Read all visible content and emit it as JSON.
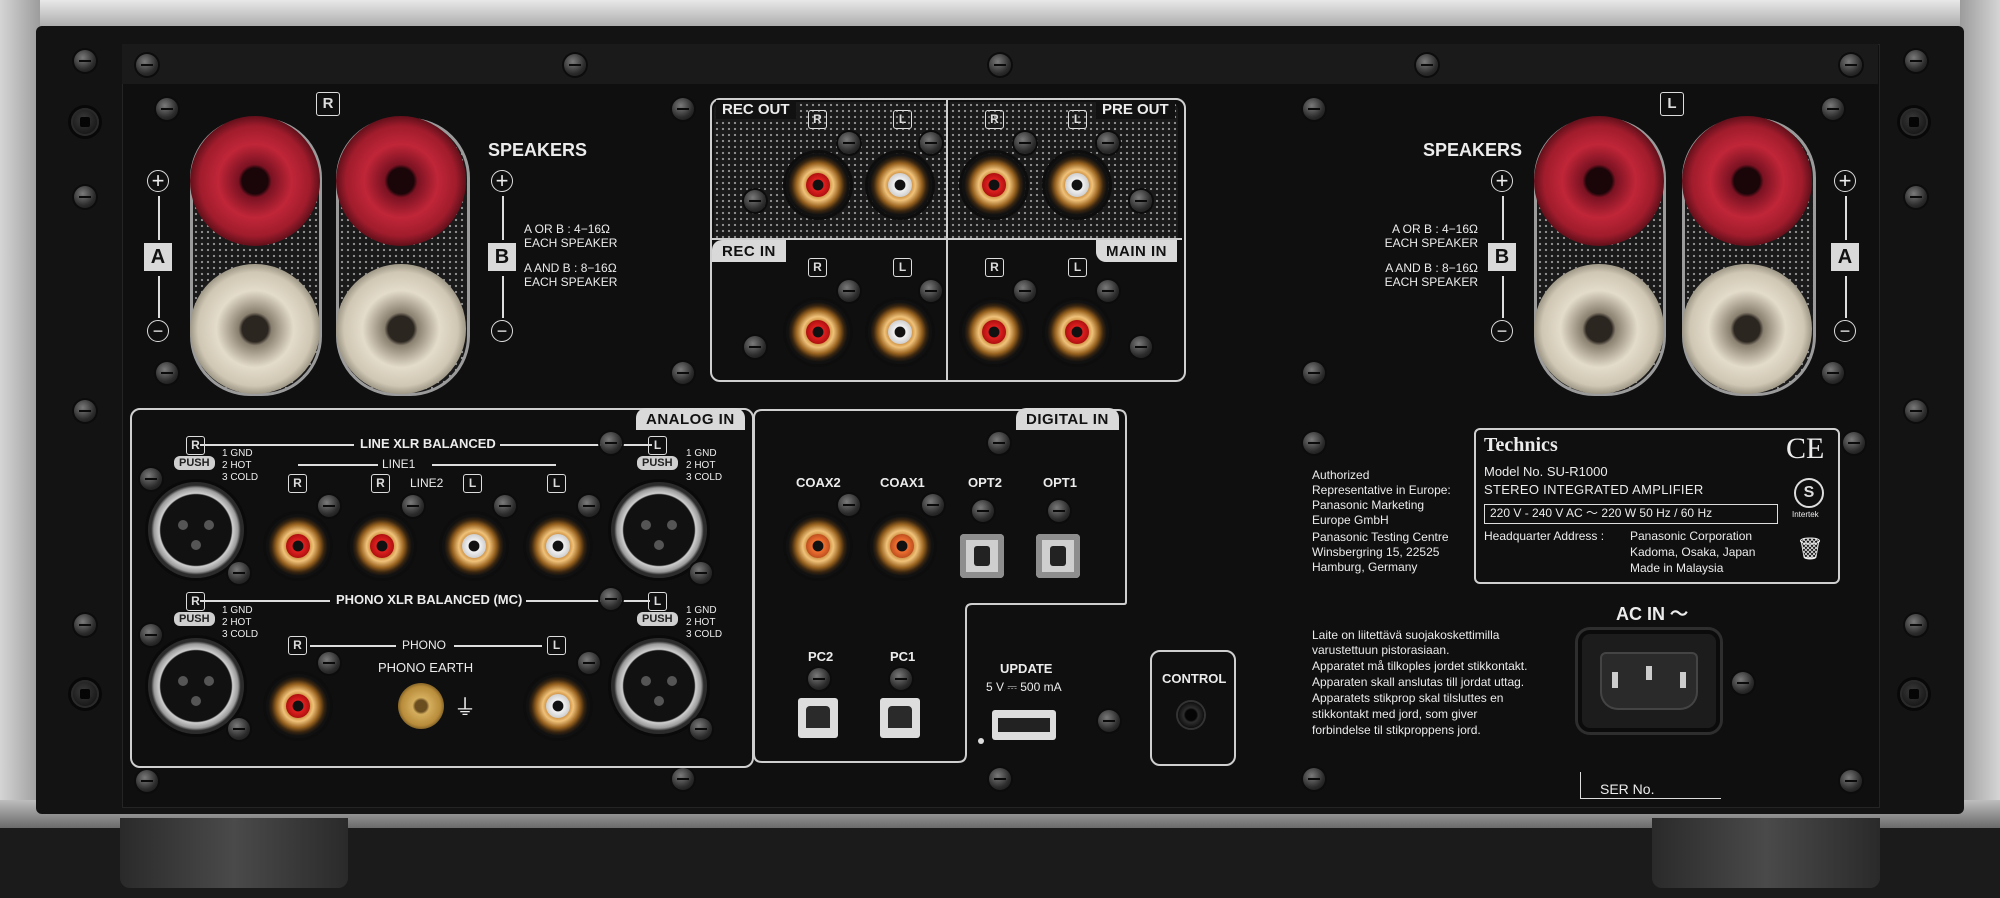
{
  "speakers_right": {
    "channel": "R",
    "title": "SPEAKERS",
    "group_a": "A",
    "group_b": "B",
    "plus": "+",
    "minus": "−",
    "spec_a_or_b_line1": "A OR B : 4−16Ω",
    "spec_a_or_b_line2": "EACH SPEAKER",
    "spec_a_and_b_line1": "A AND B : 8−16Ω",
    "spec_a_and_b_line2": "EACH SPEAKER"
  },
  "speakers_left": {
    "channel": "L",
    "title": "SPEAKERS",
    "group_a": "A",
    "group_b": "B",
    "plus": "+",
    "minus": "−",
    "spec_a_or_b_line1": "A OR B : 4−16Ω",
    "spec_a_or_b_line2": "EACH SPEAKER",
    "spec_a_and_b_line1": "A AND B : 8−16Ω",
    "spec_a_and_b_line2": "EACH SPEAKER"
  },
  "rec_pre": {
    "rec_out": "REC OUT",
    "pre_out": "PRE OUT",
    "rec_in": "REC IN",
    "main_in": "MAIN IN",
    "r": "R",
    "l": "L"
  },
  "analog_in": {
    "tab": "ANALOG IN",
    "line_xlr": "LINE XLR BALANCED",
    "line1": "LINE1",
    "line2": "LINE2",
    "phono_xlr": "PHONO XLR BALANCED (MC)",
    "phono": "PHONO",
    "phono_earth": "PHONO EARTH",
    "push": "PUSH",
    "pin1": "1 GND",
    "pin2": "2 HOT",
    "pin3": "3 COLD",
    "r": "R",
    "l": "L"
  },
  "digital_in": {
    "tab": "DIGITAL IN",
    "coax2": "COAX2",
    "coax1": "COAX1",
    "opt2": "OPT2",
    "opt1": "OPT1",
    "pc2": "PC2",
    "pc1": "PC1"
  },
  "update": {
    "label": "UPDATE",
    "spec": "5 V ⎓ 500 mA"
  },
  "control": {
    "label": "CONTROL"
  },
  "authorized": {
    "lines": [
      "Authorized",
      "Representative in Europe:",
      "Panasonic Marketing",
      "Europe GmbH",
      "Panasonic Testing Centre",
      "Winsbergring 15, 22525",
      "Hamburg, Germany"
    ]
  },
  "rating_plate": {
    "brand": "Technics",
    "model": "Model No.  SU-R1000",
    "type": "STEREO INTEGRATED AMPLIFIER",
    "power": "220 V - 240 V   AC   〜   220 W   50 Hz / 60 Hz",
    "hq_label": "Headquarter Address :",
    "hq_line1": "Panasonic Corporation",
    "hq_line2": "Kadoma, Osaka, Japan",
    "made_in": "Made in Malaysia",
    "ce": "CE",
    "intertek": "Intertek"
  },
  "safety_notice": {
    "lines": [
      "Laite on liitettävä suojakoskettimilla",
      "varustettuun pistorasiaan.",
      "Apparatet må tilkoples jordet stikkontakt.",
      "Apparaten skall anslutas till jordat uttag.",
      "Apparatets stikprop skal tilsluttes en",
      "stikkontakt med jord, som giver",
      "forbindelse til stikproppens jord."
    ]
  },
  "ac_in": {
    "label": "AC IN 〜"
  },
  "serial": {
    "label": "SER No."
  },
  "colors": {
    "panel": "#121213",
    "chassis_silver": "#c9c9c9",
    "label_white": "#ececec",
    "binding_red": "#c02638",
    "binding_cream": "#e4dccb",
    "rca_gold": "#d9a45a"
  }
}
